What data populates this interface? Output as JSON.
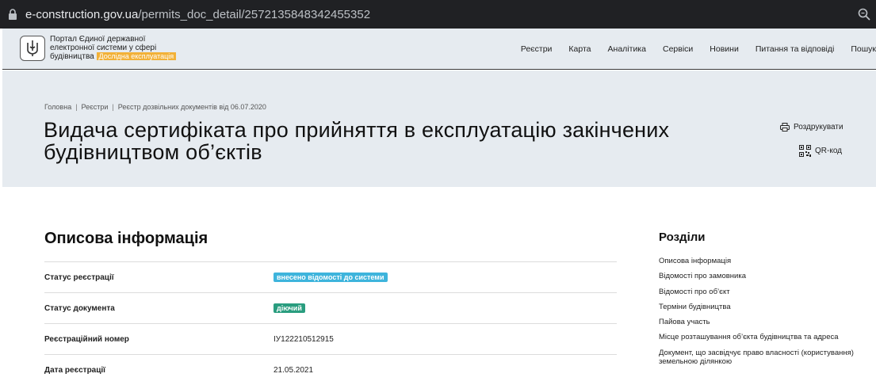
{
  "browser": {
    "url_host": "e-construction.gov.ua",
    "url_path": "/permits_doc_detail/2572135848342455352"
  },
  "header": {
    "brand_line1": "Портал Єдиної державної",
    "brand_line2": "електронної системи у сфері",
    "brand_line3": "будівництва",
    "beta_badge": "Дослідна експлуатація",
    "nav": [
      "Реєстри",
      "Карта",
      "Аналітика",
      "Сервіси",
      "Новини",
      "Питання та відповіді",
      "Пошук"
    ]
  },
  "breadcrumb": [
    "Головна",
    "Реєстри",
    "Реєстр дозвільних документів від 06.07.2020"
  ],
  "page": {
    "title": "Видача сертифіката про прийняття в експлуатацію закінчених будівництвом об’єктів",
    "print_label": "Роздрукувати",
    "qr_label": "QR-код"
  },
  "section": {
    "title": "Описова інформація",
    "rows": [
      {
        "label": "Статус реєстрації",
        "value": "внесено відомості до системи",
        "kind": "chip",
        "color": "#3eb4dc"
      },
      {
        "label": "Статус документа",
        "value": "діючий",
        "kind": "chip",
        "color": "#2a9d7f"
      },
      {
        "label": "Реєстраційний номер",
        "value": "ІУ122210512915",
        "kind": "text"
      },
      {
        "label": "Дата реєстрації",
        "value": "21.05.2021",
        "kind": "text"
      }
    ]
  },
  "sidebar": {
    "title": "Розділи",
    "items": [
      "Описова інформація",
      "Відомості про замовника",
      "Відомості про об’єкт",
      "Терміни будівництва",
      "Пайова участь",
      "Місце розташування об’єкта будівництва та адреса",
      "Документ, що засвідчує право власності (користування) земельною ділянкою"
    ]
  }
}
